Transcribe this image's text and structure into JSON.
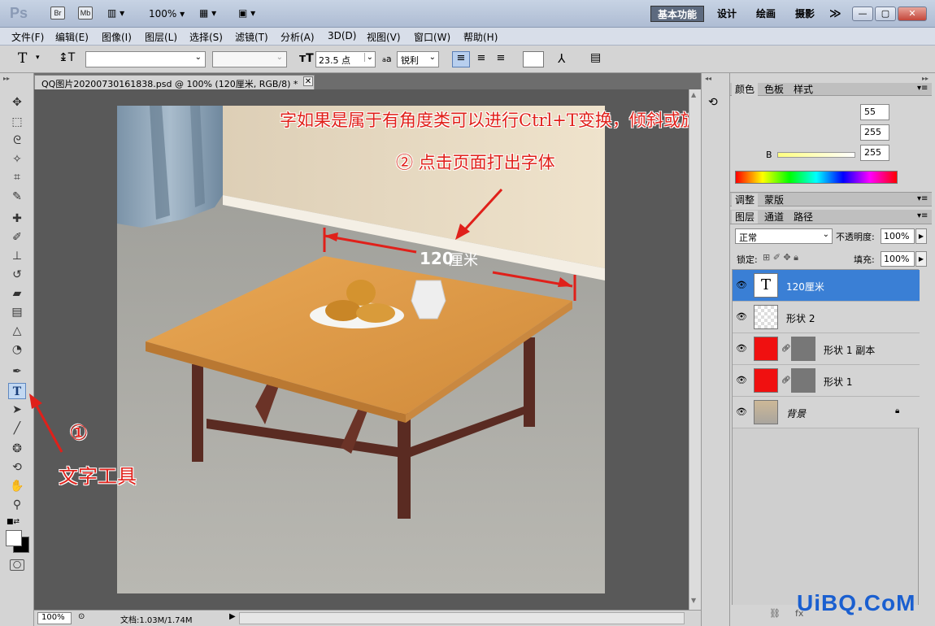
{
  "titlebar": {
    "logo": "Ps",
    "btn_br": "Br",
    "btn_mb": "Mb",
    "zoom": "100%",
    "workspaces": [
      "基本功能",
      "设计",
      "绘画",
      "摄影"
    ],
    "more": "≫"
  },
  "menu": [
    "文件(F)",
    "编辑(E)",
    "图像(I)",
    "图层(L)",
    "选择(S)",
    "滤镜(T)",
    "分析(A)",
    "3D(D)",
    "视图(V)",
    "窗口(W)",
    "帮助(H)"
  ],
  "options": {
    "font_size": "23.5 点",
    "aa_label": "a",
    "aa_mode": "锐利"
  },
  "document": {
    "tab_title": "QQ图片20200730161838.psd @ 100% (120厘米, RGB/8) *",
    "close": "✕",
    "canvas_label_number": "120",
    "canvas_label_unit": "厘米"
  },
  "annotations": {
    "top": "字如果是属于有角度类可以进行Ctrl+T变换，倾斜或旋转等",
    "step2": "② 点击页面打出字体",
    "step1_num": "①",
    "step1_label": "文字工具"
  },
  "status": {
    "zoom": "100%",
    "doc_info": "文档:1.03M/1.74M"
  },
  "color_panel": {
    "tabs": [
      "颜色",
      "色板",
      "样式"
    ],
    "r_value": "55",
    "g_value": "255",
    "b_label": "B",
    "b_value": "255"
  },
  "adjust_panel": {
    "tabs": [
      "调整",
      "蒙版"
    ]
  },
  "layers_panel": {
    "tabs": [
      "图层",
      "通道",
      "路径"
    ],
    "blend_mode": "正常",
    "opacity_label": "不透明度:",
    "opacity_value": "100%",
    "lock_label": "锁定:",
    "fill_label": "填充:",
    "fill_value": "100%",
    "layers": [
      {
        "name": "120厘米",
        "type": "text",
        "selected": true
      },
      {
        "name": "形状 2",
        "type": "empty"
      },
      {
        "name": "形状 1 副本",
        "type": "shape"
      },
      {
        "name": "形状 1",
        "type": "shape"
      },
      {
        "name": "背景",
        "type": "image",
        "locked": true
      }
    ]
  },
  "watermark": "UiBQ.CoM",
  "colors": {
    "accent": "#0a64c8",
    "annotation_red": "#e0201a",
    "selected_layer": "#3a7fd5"
  }
}
